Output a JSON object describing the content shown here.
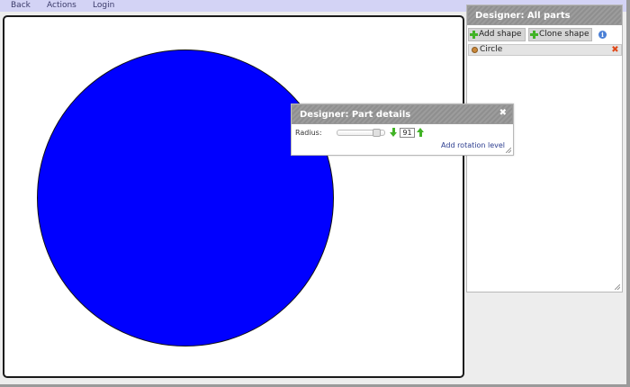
{
  "menu": {
    "back": "Back",
    "actions": "Actions",
    "login": "Login"
  },
  "canvas": {
    "shape": "circle",
    "fill_color": "#0000ff",
    "stroke_color": "#111111"
  },
  "parts_panel": {
    "title": "Designer: All parts",
    "add_shape": "Add shape",
    "clone_shape": "Clone shape",
    "info_icon": "i",
    "parts": [
      {
        "label": "Circle",
        "icon": "eye-icon",
        "delete_icon": "✖"
      }
    ]
  },
  "details_panel": {
    "title": "Designer: Part details",
    "close": "✖",
    "radius_label": "Radius:",
    "radius_value": "91",
    "radius_slider_fraction": 0.86,
    "add_rotation": "Add rotation level"
  },
  "colors": {
    "menubar": "#d3d3f5",
    "panel_header": "#9c9c9c",
    "accent_green": "#41b326",
    "delete_red": "#e04a1a"
  }
}
